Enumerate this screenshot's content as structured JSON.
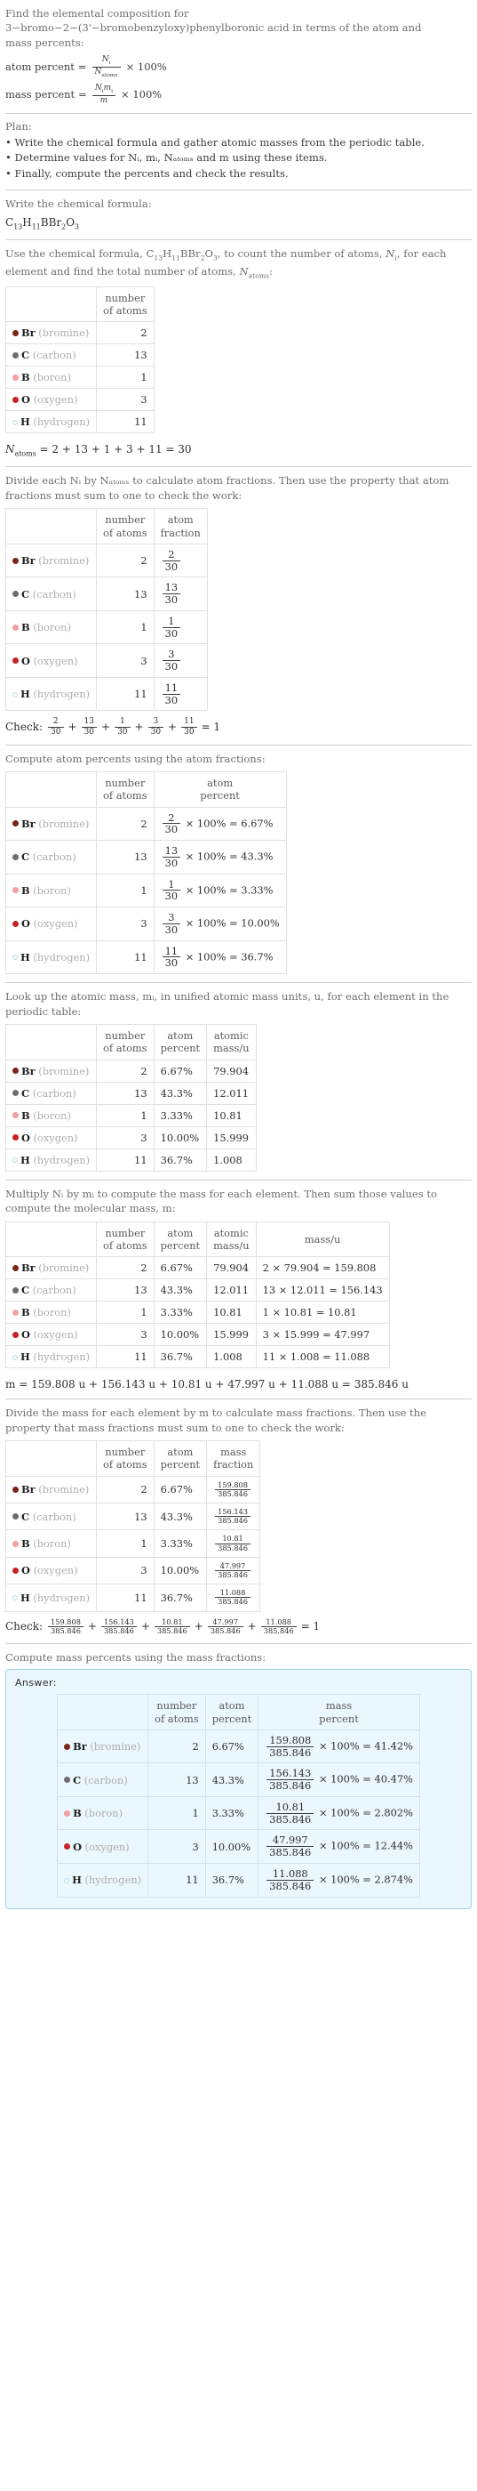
{
  "problem": {
    "line1": "Find the elemental composition for",
    "line2": "3−bromo−2−(3'−bromobenzyloxy)phenylboronic acid in terms of the atom and",
    "line3": "mass percents:",
    "atom_percent_label": "atom percent",
    "mass_percent_label": "mass percent",
    "equals": "=",
    "times100": "× 100%",
    "Ni": "N",
    "Ni_sub": "i",
    "Natoms": "N",
    "Natoms_sub": "atoms",
    "Nimi_num": "Nᵢmᵢ",
    "m": "m"
  },
  "plan": {
    "label": "Plan:",
    "bullets": [
      "Write the chemical formula and gather atomic masses from the periodic table.",
      "Determine values for Nᵢ, mᵢ, Nₐₜₒₘₛ and m using these items.",
      "Finally, compute the percents and check the results."
    ]
  },
  "formula_step": {
    "label": "Write the chemical formula:",
    "formula": "C13H11BBr2O3"
  },
  "count_step": {
    "text_a": "Use the chemical formula, ",
    "text_b": ", to count the number of atoms, ",
    "text_c": ", for each element and find the total number of atoms, ",
    "text_d": ":",
    "total_eq": "N",
    "total_sub": "atoms",
    "total_expr": "= 2 + 13 + 1 + 3 + 11 = 30",
    "headers": [
      "",
      "number of atoms"
    ]
  },
  "fraction_step": {
    "text": "Divide each Nᵢ by Nₐₜₒₘₛ to calculate atom fractions. Then use the property that atom fractions must sum to one to check the work:",
    "headers": [
      "",
      "number of atoms",
      "atom fraction"
    ],
    "check_label": "Check:",
    "check_result": "= 1"
  },
  "atom_percent_step": {
    "text": "Compute atom percents using the atom fractions:",
    "headers": [
      "",
      "number of atoms",
      "atom percent"
    ]
  },
  "atomic_mass_step": {
    "text": "Look up the atomic mass, mᵢ, in unified atomic mass units, u, for each element in the periodic table:",
    "headers": [
      "",
      "number of atoms",
      "atom percent",
      "atomic mass/u"
    ]
  },
  "mass_step": {
    "text": "Multiply Nᵢ by mᵢ to compute the mass for each element. Then sum those values to compute the molecular mass, m:",
    "headers": [
      "",
      "number of atoms",
      "atom percent",
      "atomic mass/u",
      "mass/u"
    ],
    "total": "m = 159.808 u + 156.143 u + 10.81 u + 47.997 u + 11.088 u = 385.846 u"
  },
  "mass_fraction_step": {
    "text": "Divide the mass for each element by m to calculate mass fractions. Then use the property that mass fractions must sum to one to check the work:",
    "headers": [
      "",
      "number of atoms",
      "atom percent",
      "mass fraction"
    ],
    "check_label": "Check:",
    "check_result": "= 1"
  },
  "mass_percent_step": {
    "text": "Compute mass percents using the mass fractions:",
    "answer_label": "Answer:",
    "headers": [
      "",
      "number of atoms",
      "atom percent",
      "mass percent"
    ]
  },
  "total_atoms": "30",
  "molecular_mass": "385.846",
  "elements": [
    {
      "symbol": "Br",
      "name": "(bromine)",
      "color": "#7b2418",
      "count": "2",
      "atom_fraction_num": "2",
      "atom_fraction_den": "30",
      "atom_percent": "6.67%",
      "atomic_mass": "79.904",
      "mass_expr": "2 × 79.904 = 159.808",
      "mass": "159.808",
      "mass_percent": "41.42%"
    },
    {
      "symbol": "C",
      "name": "(carbon)",
      "color": "#6e6e6e",
      "count": "13",
      "atom_fraction_num": "13",
      "atom_fraction_den": "30",
      "atom_percent": "43.3%",
      "atomic_mass": "12.011",
      "mass_expr": "13 × 12.011 = 156.143",
      "mass": "156.143",
      "mass_percent": "40.47%"
    },
    {
      "symbol": "B",
      "name": "(boron)",
      "color": "#f2a0a0",
      "count": "1",
      "atom_fraction_num": "1",
      "atom_fraction_den": "30",
      "atom_percent": "3.33%",
      "atomic_mass": "10.81",
      "mass_expr": "1 × 10.81 = 10.81",
      "mass": "10.81",
      "mass_percent": "2.802%"
    },
    {
      "symbol": "O",
      "name": "(oxygen)",
      "color": "#c62222",
      "count": "3",
      "atom_fraction_num": "3",
      "atom_fraction_den": "30",
      "atom_percent": "10.00%",
      "atomic_mass": "15.999",
      "mass_expr": "3 × 15.999 = 47.997",
      "mass": "47.997",
      "mass_percent": "12.44%"
    },
    {
      "symbol": "H",
      "name": "(hydrogen)",
      "color": "#f2fbfd",
      "count": "11",
      "atom_fraction_num": "11",
      "atom_fraction_den": "30",
      "atom_percent": "36.7%",
      "atomic_mass": "1.008",
      "mass_expr": "11 × 1.008 = 11.088",
      "mass": "11.088",
      "mass_percent": "2.874%"
    }
  ],
  "symbols": {
    "times": "×",
    "plus": "+",
    "equals": "=",
    "pct100": "× 100%"
  }
}
